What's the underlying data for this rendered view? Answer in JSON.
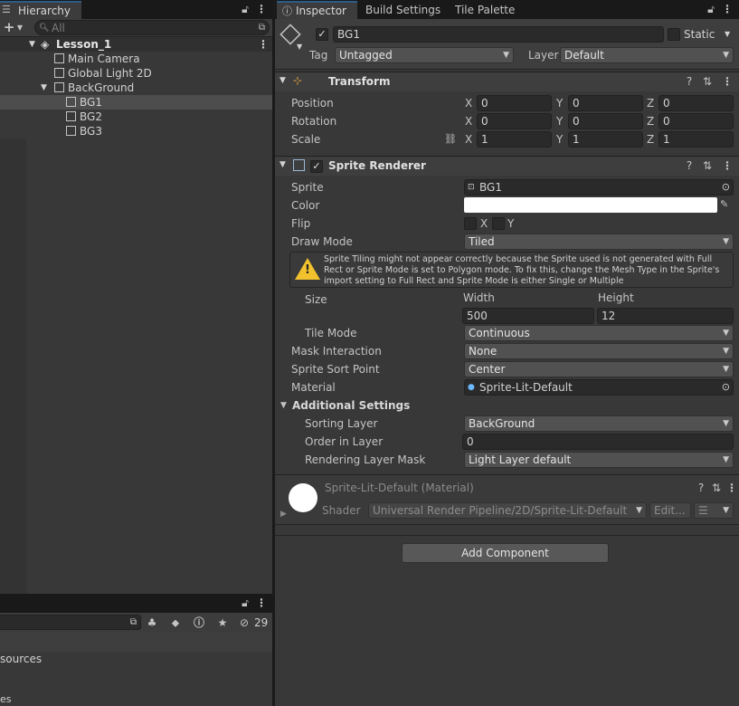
{
  "hierarchy": {
    "tab": "Hierarchy",
    "search_placeholder": "All",
    "scene": "Lesson_1",
    "items": [
      {
        "label": "Main Camera"
      },
      {
        "label": "Global Light 2D"
      },
      {
        "label": "BackGround"
      },
      {
        "label": "BG1"
      },
      {
        "label": "BG2"
      },
      {
        "label": "BG3"
      }
    ]
  },
  "project": {
    "hidden_count": "29",
    "row1": "sources",
    "row2": "es"
  },
  "tabs": [
    "Inspector",
    "Build Settings",
    "Tile Palette"
  ],
  "object": {
    "name": "BG1",
    "static_label": "Static",
    "tag_label": "Tag",
    "tag_value": "Untagged",
    "layer_label": "Layer",
    "layer_value": "Default"
  },
  "transform": {
    "title": "Transform",
    "rows": [
      {
        "label": "Position",
        "x": "0",
        "y": "0",
        "z": "0"
      },
      {
        "label": "Rotation",
        "x": "0",
        "y": "0",
        "z": "0"
      },
      {
        "label": "Scale",
        "x": "1",
        "y": "1",
        "z": "1"
      }
    ],
    "axis": [
      "X",
      "Y",
      "Z"
    ]
  },
  "sprite_renderer": {
    "title": "Sprite Renderer",
    "sprite_label": "Sprite",
    "sprite_value": "BG1",
    "color_label": "Color",
    "color_value": "#ffffff",
    "flip_label": "Flip",
    "flip_x": "X",
    "flip_y": "Y",
    "draw_mode_label": "Draw Mode",
    "draw_mode_value": "Tiled",
    "warning": "Sprite Tiling might not appear correctly because the Sprite used is not generated with Full Rect or Sprite Mode is set to Polygon mode. To fix this, change the Mesh Type in the Sprite's import setting to Full Rect and Sprite Mode is either Single or Multiple",
    "size_label": "Size",
    "width_label": "Width",
    "height_label": "Height",
    "width_value": "500",
    "height_value": "12",
    "tile_mode_label": "Tile Mode",
    "tile_mode_value": "Continuous",
    "mask_label": "Mask Interaction",
    "mask_value": "None",
    "sort_point_label": "Sprite Sort Point",
    "sort_point_value": "Center",
    "material_label": "Material",
    "material_value": "Sprite-Lit-Default",
    "additional_label": "Additional Settings",
    "sorting_layer_label": "Sorting Layer",
    "sorting_layer_value": "BackGround",
    "order_label": "Order in Layer",
    "order_value": "0",
    "rlm_label": "Rendering Layer Mask",
    "rlm_value": "Light Layer default"
  },
  "material": {
    "title": "Sprite-Lit-Default (Material)",
    "shader_label": "Shader",
    "shader_value": "Universal Render Pipeline/2D/Sprite-Lit-Default",
    "edit_label": "Edit..."
  },
  "add_component": "Add Component",
  "colors": {
    "panel": "#383838",
    "header": "#3e3e3e",
    "tabbar": "#191919",
    "selection": "#4d4d4d",
    "warning_yellow": "#f2c12e",
    "accent": "#2c5d87"
  }
}
